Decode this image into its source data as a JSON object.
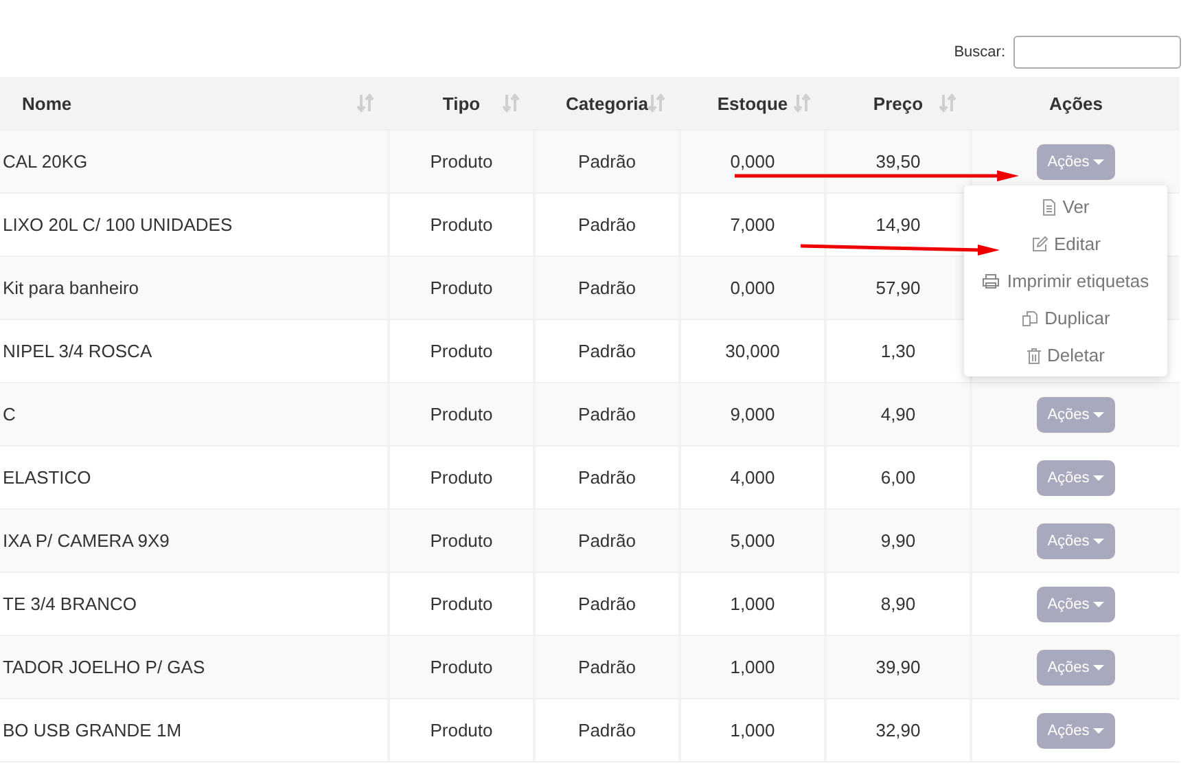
{
  "search": {
    "label": "Buscar:"
  },
  "table": {
    "columns": [
      {
        "label": "Nome",
        "sortable": true
      },
      {
        "label": "Tipo",
        "sortable": true
      },
      {
        "label": "Categoria",
        "sortable": true
      },
      {
        "label": "Estoque",
        "sortable": true
      },
      {
        "label": "Preço",
        "sortable": true
      },
      {
        "label": "Ações",
        "sortable": false
      }
    ],
    "rows": [
      {
        "name": "CAL 20KG",
        "type": "Produto",
        "category": "Padrão",
        "stock": "0,000",
        "price": "39,50",
        "action": "Ações"
      },
      {
        "name": "LIXO 20L C/ 100 UNIDADES",
        "type": "Produto",
        "category": "Padrão",
        "stock": "7,000",
        "price": "14,90"
      },
      {
        "name": "Kit para banheiro",
        "type": "Produto",
        "category": "Padrão",
        "stock": "0,000",
        "price": "57,90"
      },
      {
        "name": "NIPEL 3/4 ROSCA",
        "type": "Produto",
        "category": "Padrão",
        "stock": "30,000",
        "price": "1,30"
      },
      {
        "name": "C",
        "type": "Produto",
        "category": "Padrão",
        "stock": "9,000",
        "price": "4,90",
        "action": "Ações"
      },
      {
        "name": "ELASTICO",
        "type": "Produto",
        "category": "Padrão",
        "stock": "4,000",
        "price": "6,00",
        "action": "Ações"
      },
      {
        "name": "IXA P/ CAMERA 9X9",
        "type": "Produto",
        "category": "Padrão",
        "stock": "5,000",
        "price": "9,90",
        "action": "Ações"
      },
      {
        "name": "TE 3/4 BRANCO",
        "type": "Produto",
        "category": "Padrão",
        "stock": "1,000",
        "price": "8,90",
        "action": "Ações"
      },
      {
        "name": "TADOR JOELHO P/ GAS",
        "type": "Produto",
        "category": "Padrão",
        "stock": "1,000",
        "price": "39,90",
        "action": "Ações"
      },
      {
        "name": "BO USB GRANDE 1M",
        "type": "Produto",
        "category": "Padrão",
        "stock": "1,000",
        "price": "32,90",
        "action": "Ações"
      }
    ]
  },
  "menu": {
    "items": [
      {
        "label": "Ver",
        "kind": "view"
      },
      {
        "label": "Editar",
        "kind": "edit"
      },
      {
        "label": "Imprimir etiquetas",
        "kind": "print"
      },
      {
        "label": "Duplicar",
        "kind": "duplicate"
      },
      {
        "label": "Deletar",
        "kind": "delete"
      }
    ]
  },
  "annotations": [
    {
      "kind": "arrow"
    },
    {
      "kind": "arrow"
    }
  ]
}
